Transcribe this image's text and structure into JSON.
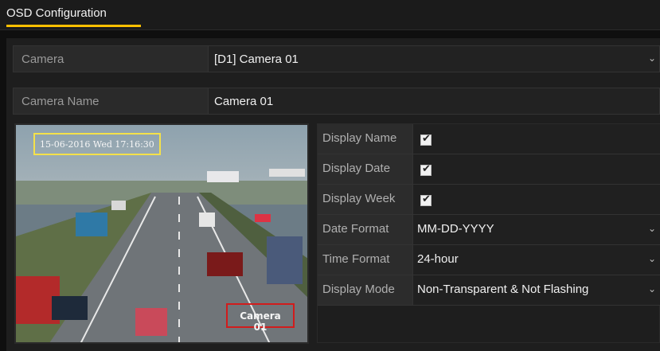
{
  "tab": {
    "label": "OSD Configuration"
  },
  "form": {
    "camera_label": "Camera",
    "camera_value": "[D1] Camera 01",
    "camera_name_label": "Camera Name",
    "camera_name_value": "Camera 01"
  },
  "preview": {
    "date_overlay": "15-06-2016 Wed 17:16:30",
    "name_overlay": "Camera 01"
  },
  "settings": [
    {
      "label": "Display Name",
      "checked": true
    },
    {
      "label": "Display Date",
      "checked": true
    },
    {
      "label": "Display Week",
      "checked": true
    },
    {
      "label": "Date Format",
      "value": "MM-DD-YYYY"
    },
    {
      "label": "Time Format",
      "value": "24-hour"
    },
    {
      "label": "Display Mode",
      "value": "Non-Transparent & Not Flashing"
    }
  ],
  "icons": {
    "checkmark": "✔",
    "chevron": "⌄"
  }
}
